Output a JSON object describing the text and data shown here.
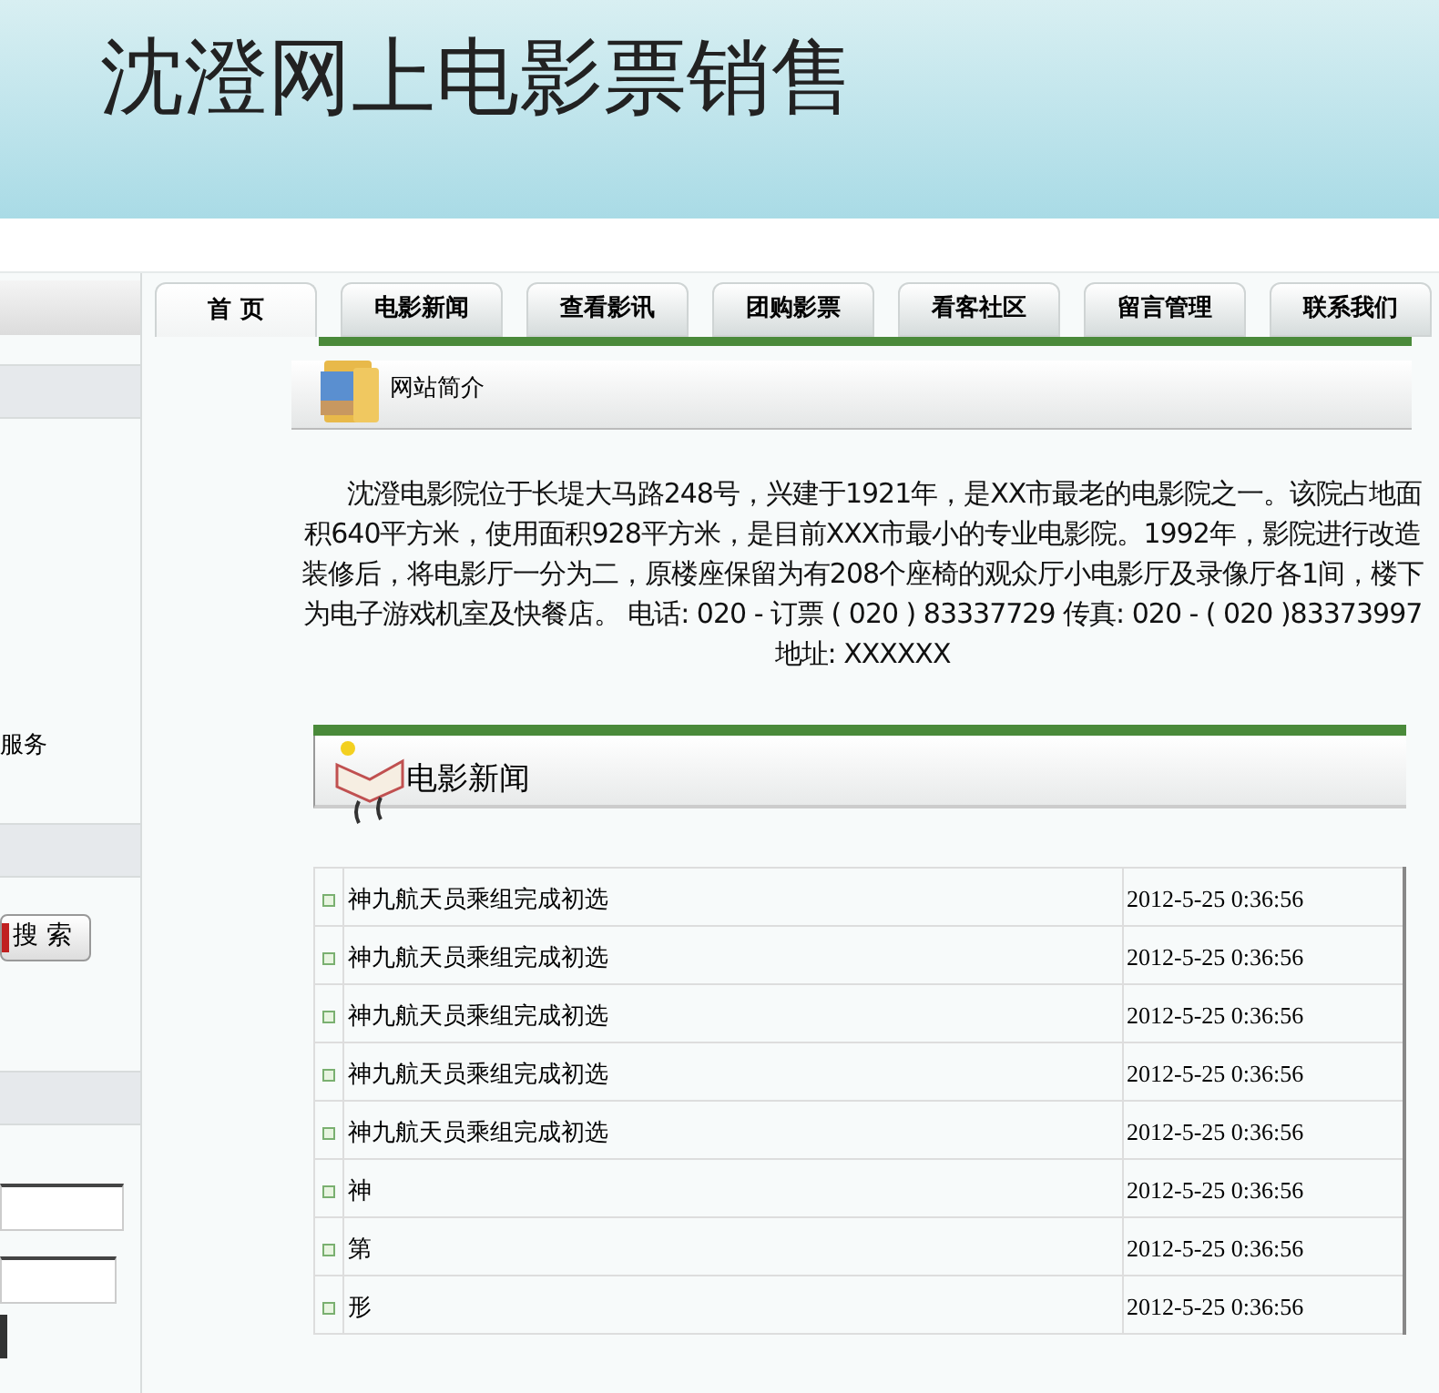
{
  "site_title": "沈澄网上电影票销售",
  "tabs": [
    {
      "label": "首 页",
      "selected": true
    },
    {
      "label": "电影新闻",
      "selected": false
    },
    {
      "label": "查看影讯",
      "selected": false
    },
    {
      "label": "团购影票",
      "selected": false
    },
    {
      "label": "看客社区",
      "selected": false
    },
    {
      "label": "留言管理",
      "selected": false
    },
    {
      "label": "联系我们",
      "selected": false
    }
  ],
  "sidebar": {
    "service_text": "服务",
    "search_button": "搜 索"
  },
  "intro": {
    "title": "网站简介",
    "text": "沈澄电影院位于长堤大马路248号，兴建于1921年，是XX市最老的电影院之一。该院占地面积640平方米，使用面积928平方米，是目前XXX市最小的专业电影院。1992年，影院进行改造装修后，将电影厅一分为二，原楼座保留为有208个座椅的观众厅小电影厅及录像厅各1间，楼下为电子游戏机室及快餐店。 电话: 020 - 订票 ( 020 ) 83337729 传真: 020 - ( 020 )83373997 地址: XXXXXX"
  },
  "news": {
    "title": "电影新闻",
    "rows": [
      {
        "title": "神九航天员乘组完成初选",
        "date": "2012-5-25 0:36:56"
      },
      {
        "title": "神九航天员乘组完成初选",
        "date": "2012-5-25 0:36:56"
      },
      {
        "title": "神九航天员乘组完成初选",
        "date": "2012-5-25 0:36:56"
      },
      {
        "title": "神九航天员乘组完成初选",
        "date": "2012-5-25 0:36:56"
      },
      {
        "title": "神九航天员乘组完成初选",
        "date": "2012-5-25 0:36:56"
      },
      {
        "title": "神",
        "date": "2012-5-25 0:36:56"
      },
      {
        "title": "第",
        "date": "2012-5-25 0:36:56"
      },
      {
        "title": "形",
        "date": "2012-5-25 0:36:56"
      }
    ]
  }
}
